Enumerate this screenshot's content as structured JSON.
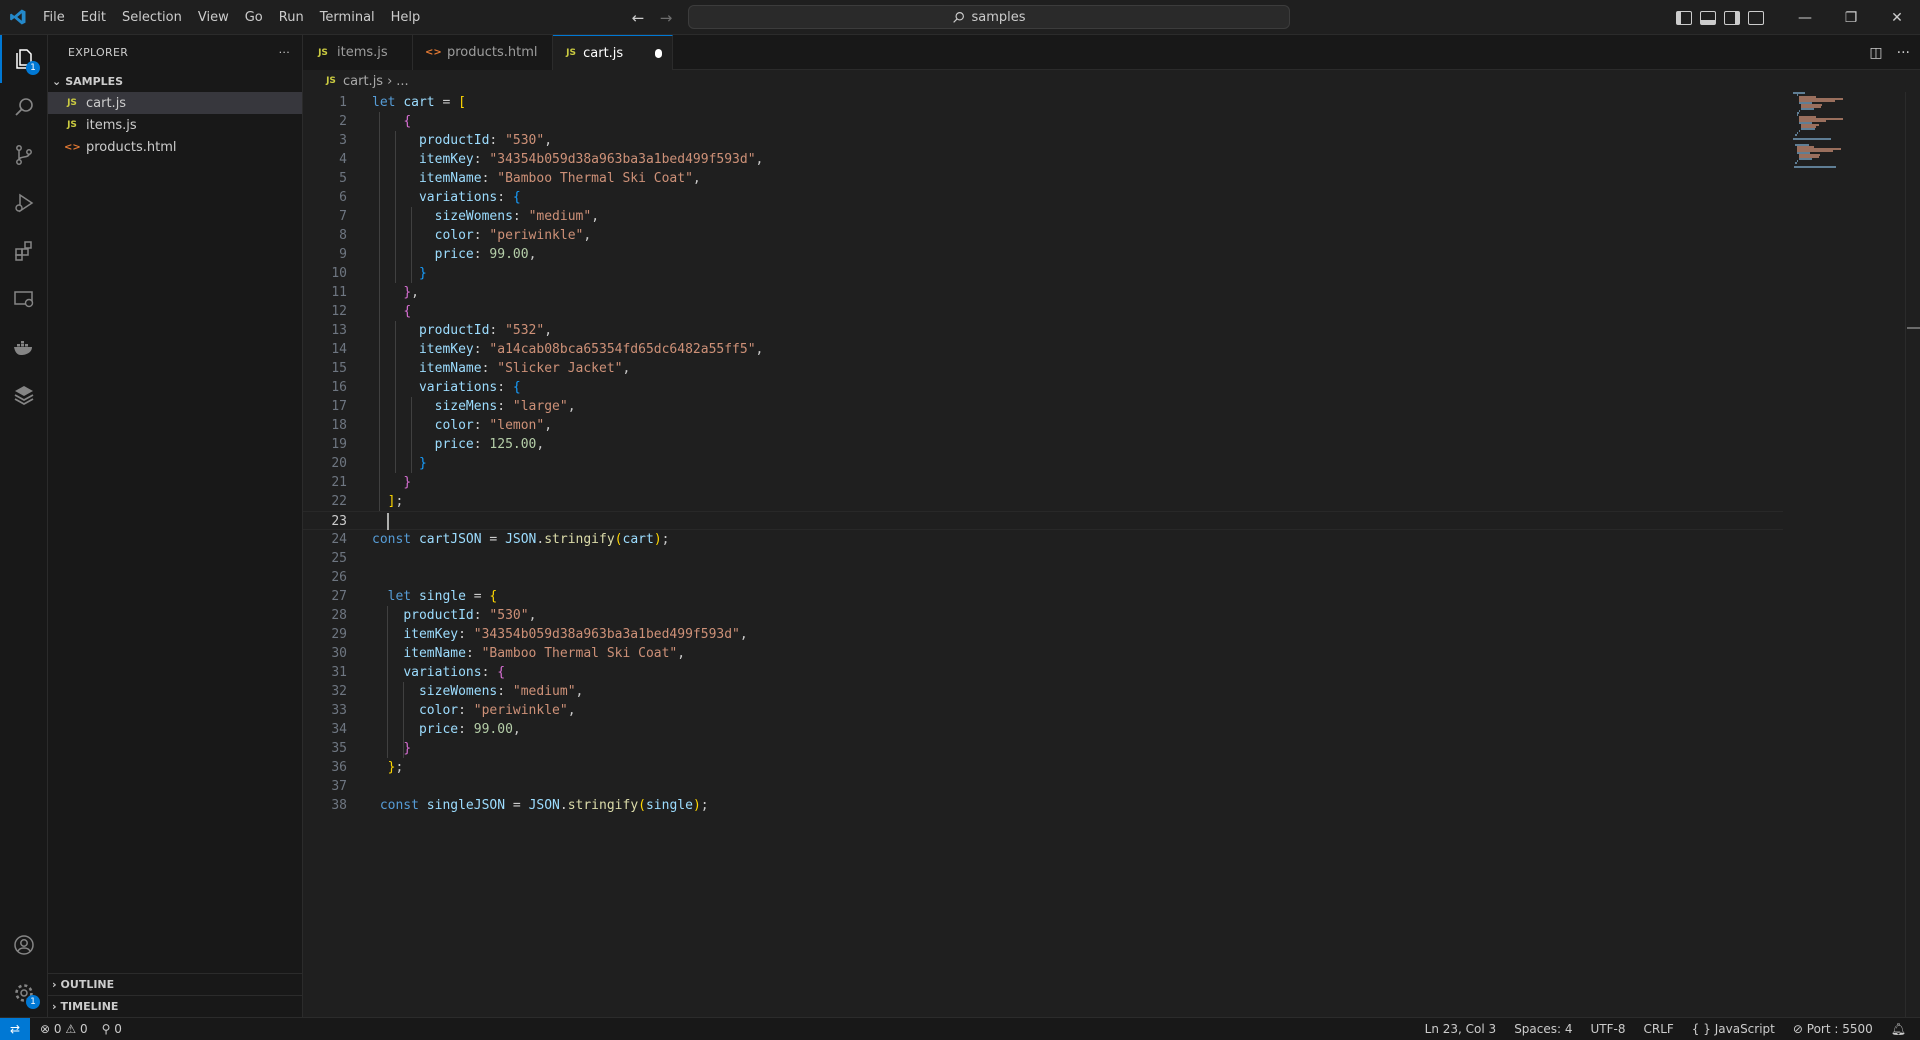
{
  "window": {
    "search_text": "samples"
  },
  "menu": [
    "File",
    "Edit",
    "Selection",
    "View",
    "Go",
    "Run",
    "Terminal",
    "Help"
  ],
  "activity": {
    "explorer_badge": "1",
    "settings_badge": "1"
  },
  "sidebar": {
    "title": "EXPLORER",
    "more": "···",
    "folder": "SAMPLES",
    "files": [
      {
        "name": "cart.js",
        "icon": "JS"
      },
      {
        "name": "items.js",
        "icon": "JS"
      },
      {
        "name": "products.html",
        "icon": "<>"
      }
    ],
    "outline": "OUTLINE",
    "timeline": "TIMELINE"
  },
  "tabs": [
    {
      "label": "items.js",
      "icon": "JS"
    },
    {
      "label": "products.html",
      "icon": "<>"
    },
    {
      "label": "cart.js",
      "icon": "JS"
    }
  ],
  "breadcrumb": {
    "icon": "JS",
    "file": "cart.js",
    "sep": "›",
    "rest": "..."
  },
  "editor": {
    "current_line": 23,
    "lines": [
      "let cart = [",
      "    {",
      "      productId: \"530\",",
      "      itemKey: \"34354b059d38a963ba3a1bed499f593d\",",
      "      itemName: \"Bamboo Thermal Ski Coat\",",
      "      variations: {",
      "        sizeWomens: \"medium\",",
      "        color: \"periwinkle\",",
      "        price: 99.00,",
      "      }",
      "    },",
      "    {",
      "      productId: \"532\",",
      "      itemKey: \"a14cab08bca65354fd65dc6482a55ff5\",",
      "      itemName: \"Slicker Jacket\",",
      "      variations: {",
      "        sizeMens: \"large\",",
      "        color: \"lemon\",",
      "        price: 125.00,",
      "      }",
      "    }",
      "  ];",
      "",
      "const cartJSON = JSON.stringify(cart);",
      "",
      "",
      "  let single = {",
      "    productId: \"530\",",
      "    itemKey: \"34354b059d38a963ba3a1bed499f593d\",",
      "    itemName: \"Bamboo Thermal Ski Coat\",",
      "    variations: {",
      "      sizeWomens: \"medium\",",
      "      color: \"periwinkle\",",
      "      price: 99.00,",
      "    }",
      "  };",
      "",
      " const singleJSON = JSON.stringify(single);"
    ]
  },
  "status": {
    "errors": "0",
    "warnings": "0",
    "ports": "0",
    "position": "Ln 23, Col 3",
    "spaces": "Spaces: 4",
    "encoding": "UTF-8",
    "eol": "CRLF",
    "language": "JavaScript",
    "port": "Port : 5500"
  },
  "colors": {
    "accent": "#0078d4",
    "keyword": "#569cd6",
    "variable": "#9cdcfe",
    "string": "#ce9178",
    "number": "#b5cea8",
    "function": "#dcdcaa"
  }
}
